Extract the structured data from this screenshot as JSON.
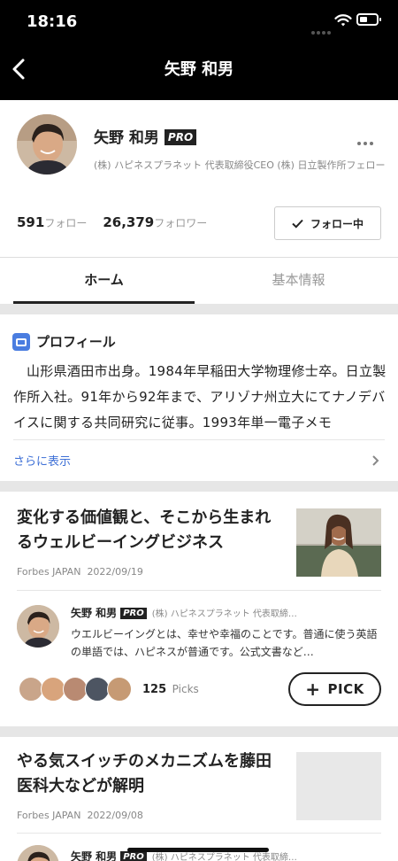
{
  "status": {
    "time": "18:16"
  },
  "header": {
    "title": "矢野 和男"
  },
  "profile": {
    "name": "矢野 和男",
    "badge": "PRO",
    "position": "(株) ハピネスプラネット 代表取締役CEO (株) 日立製作所フェロー",
    "following_count": "591",
    "following_label": "フォロー",
    "followers_count": "26,379",
    "followers_label": "フォロワー",
    "follow_button": "フォロー中"
  },
  "tabs": [
    {
      "label": "ホーム",
      "active": true
    },
    {
      "label": "基本情報",
      "active": false
    }
  ],
  "intro": {
    "heading": "プロフィール",
    "body": "山形県酒田市出身。1984年早稲田大学物理修士卒。日立製作所入社。91年から92年まで、アリゾナ州立大にてナノデバイスに関する共同研究に従事。1993年単一電子メモ",
    "show_more": "さらに表示"
  },
  "articles": [
    {
      "title": "変化する価値観と、そこから生まれるウェルビーイングビジネス",
      "source": "Forbes JAPAN",
      "date": "2022/09/19",
      "comment": {
        "name": "矢野 和男",
        "badge": "PRO",
        "position": "(株) ハピネスプラネット 代表取締…",
        "text": "ウエルビーイングとは、幸せや幸福のことです。普通に使う英語の単語では、ハピネスが普通です。公式文書など…"
      },
      "picks_count": "125",
      "picks_label": "Picks",
      "pick_button": "PICK"
    },
    {
      "title": "やる気スイッチのメカニズムを藤田医科大などが解明",
      "source": "Forbes JAPAN",
      "date": "2022/09/08",
      "comment": {
        "name": "矢野 和男",
        "badge": "PRO",
        "position": "(株) ハピネスプラネット 代表取締…"
      }
    }
  ],
  "colors": {
    "accent": "#3d6fd6",
    "header": "#000000",
    "badge": "#222222"
  }
}
